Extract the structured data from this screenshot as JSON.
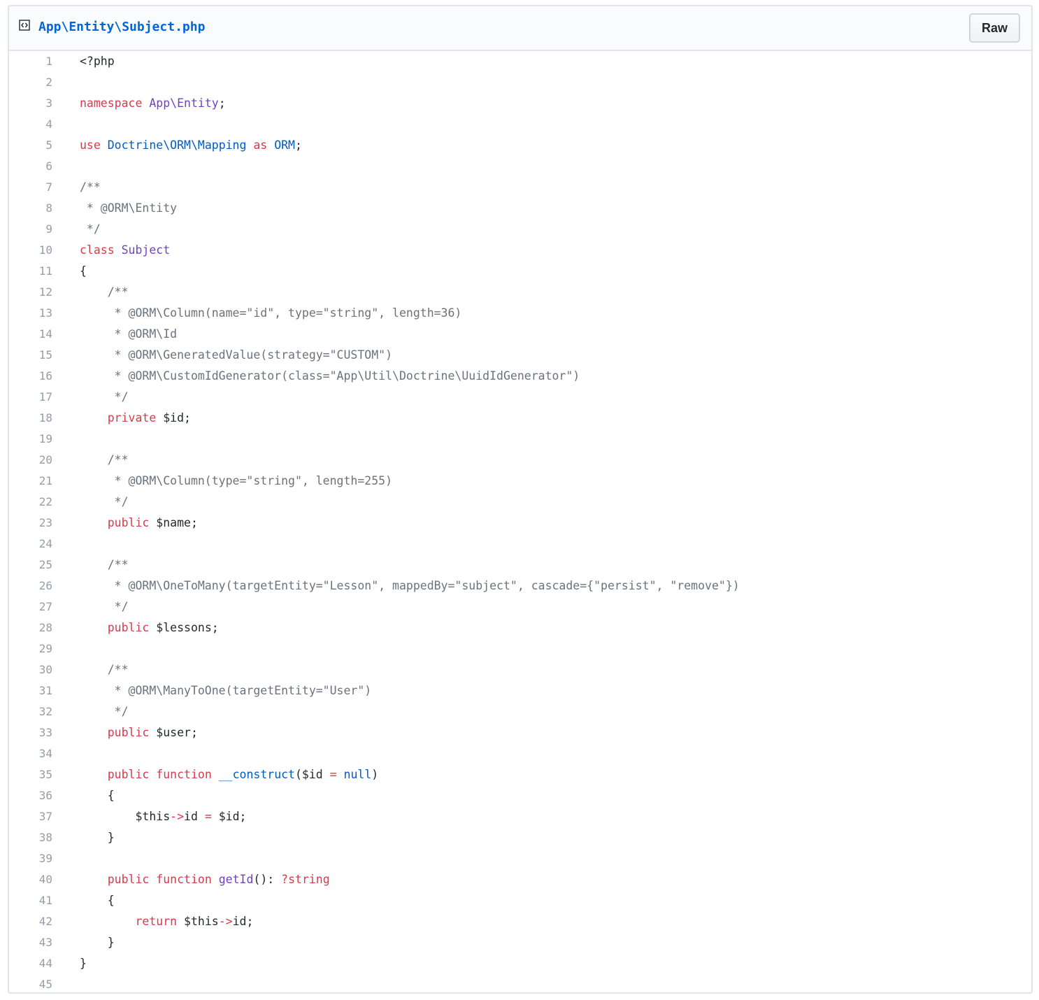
{
  "file": {
    "path": "App\\Entity\\Subject.php",
    "raw_label": "Raw"
  },
  "colors": {
    "keyword": "#d73a49",
    "entity": "#6f42c1",
    "constant": "#005cc5",
    "comment": "#6a737d",
    "plain": "#24292e",
    "line_number": "#959da5",
    "link": "#0366d6"
  },
  "code": [
    [
      [
        "p",
        "<?php"
      ]
    ],
    [],
    [
      [
        "k",
        "namespace"
      ],
      [
        "p",
        " "
      ],
      [
        "e",
        "App\\Entity"
      ],
      [
        "p",
        ";"
      ]
    ],
    [],
    [
      [
        "k",
        "use"
      ],
      [
        "p",
        " "
      ],
      [
        "c",
        "Doctrine\\ORM\\Mapping"
      ],
      [
        "p",
        " "
      ],
      [
        "k",
        "as"
      ],
      [
        "p",
        " "
      ],
      [
        "c",
        "ORM"
      ],
      [
        "p",
        ";"
      ]
    ],
    [],
    [
      [
        "m",
        "/**"
      ]
    ],
    [
      [
        "m",
        " * @ORM\\Entity"
      ]
    ],
    [
      [
        "m",
        " */"
      ]
    ],
    [
      [
        "k",
        "class"
      ],
      [
        "p",
        " "
      ],
      [
        "e",
        "Subject"
      ]
    ],
    [
      [
        "p",
        "{"
      ]
    ],
    [
      [
        "m",
        "    /**"
      ]
    ],
    [
      [
        "m",
        "     * @ORM\\Column(name=\"id\", type=\"string\", length=36)"
      ]
    ],
    [
      [
        "m",
        "     * @ORM\\Id"
      ]
    ],
    [
      [
        "m",
        "     * @ORM\\GeneratedValue(strategy=\"CUSTOM\")"
      ]
    ],
    [
      [
        "m",
        "     * @ORM\\CustomIdGenerator(class=\"App\\Util\\Doctrine\\UuidIdGenerator\")"
      ]
    ],
    [
      [
        "m",
        "     */"
      ]
    ],
    [
      [
        "p",
        "    "
      ],
      [
        "k",
        "private"
      ],
      [
        "p",
        " $id;"
      ]
    ],
    [],
    [
      [
        "m",
        "    /**"
      ]
    ],
    [
      [
        "m",
        "     * @ORM\\Column(type=\"string\", length=255)"
      ]
    ],
    [
      [
        "m",
        "     */"
      ]
    ],
    [
      [
        "p",
        "    "
      ],
      [
        "k",
        "public"
      ],
      [
        "p",
        " $name;"
      ]
    ],
    [],
    [
      [
        "m",
        "    /**"
      ]
    ],
    [
      [
        "m",
        "     * @ORM\\OneToMany(targetEntity=\"Lesson\", mappedBy=\"subject\", cascade={\"persist\", \"remove\"})"
      ]
    ],
    [
      [
        "m",
        "     */"
      ]
    ],
    [
      [
        "p",
        "    "
      ],
      [
        "k",
        "public"
      ],
      [
        "p",
        " $lessons;"
      ]
    ],
    [],
    [
      [
        "m",
        "    /**"
      ]
    ],
    [
      [
        "m",
        "     * @ORM\\ManyToOne(targetEntity=\"User\")"
      ]
    ],
    [
      [
        "m",
        "     */"
      ]
    ],
    [
      [
        "p",
        "    "
      ],
      [
        "k",
        "public"
      ],
      [
        "p",
        " $user;"
      ]
    ],
    [],
    [
      [
        "p",
        "    "
      ],
      [
        "k",
        "public"
      ],
      [
        "p",
        " "
      ],
      [
        "k",
        "function"
      ],
      [
        "p",
        " "
      ],
      [
        "c",
        "__construct"
      ],
      [
        "p",
        "($id "
      ],
      [
        "k",
        "="
      ],
      [
        "p",
        " "
      ],
      [
        "c",
        "null"
      ],
      [
        "p",
        ")"
      ]
    ],
    [
      [
        "p",
        "    {"
      ]
    ],
    [
      [
        "p",
        "        $this"
      ],
      [
        "k",
        "->"
      ],
      [
        "p",
        "id "
      ],
      [
        "k",
        "="
      ],
      [
        "p",
        " $id;"
      ]
    ],
    [
      [
        "p",
        "    }"
      ]
    ],
    [],
    [
      [
        "p",
        "    "
      ],
      [
        "k",
        "public"
      ],
      [
        "p",
        " "
      ],
      [
        "k",
        "function"
      ],
      [
        "p",
        " "
      ],
      [
        "e",
        "getId"
      ],
      [
        "p",
        "(): "
      ],
      [
        "k",
        "?string"
      ]
    ],
    [
      [
        "p",
        "    {"
      ]
    ],
    [
      [
        "p",
        "        "
      ],
      [
        "k",
        "return"
      ],
      [
        "p",
        " $this"
      ],
      [
        "k",
        "->"
      ],
      [
        "p",
        "id;"
      ]
    ],
    [
      [
        "p",
        "    }"
      ]
    ],
    [
      [
        "p",
        "}"
      ]
    ],
    []
  ]
}
